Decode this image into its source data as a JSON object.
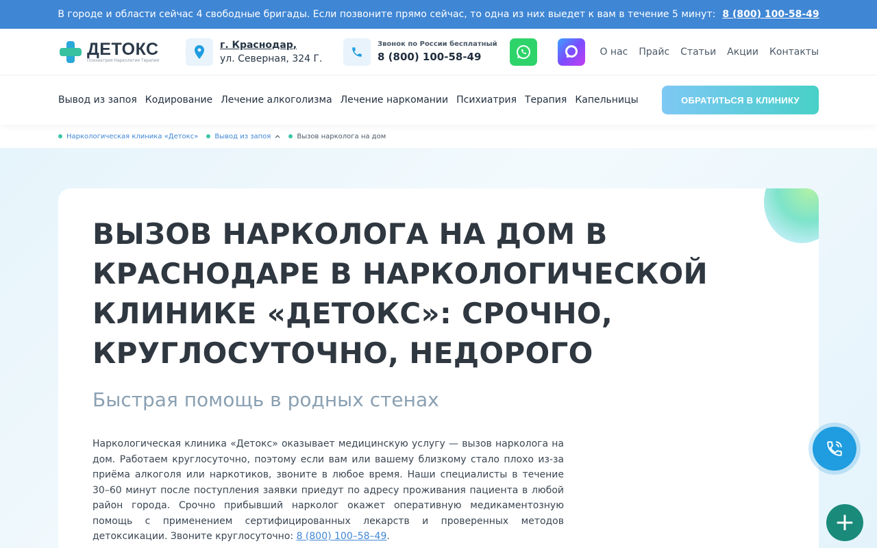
{
  "banner": {
    "text": "В городе и области сейчас 4 свободные бригады. Если позвоните прямо сейчас, то одна из них выедет к вам в течение 5 минут:",
    "phone": "8 (800) 100-58-49"
  },
  "header": {
    "logo_name": "ДЕТОКС",
    "logo_sub": "Психиатрия Наркология Терапия",
    "city": "г. Краснодар,",
    "street": "ул. Северная, 324 Г.",
    "phone_caption": "Звонок по России бесплатный",
    "phone": "8 (800) 100-58-49",
    "top_nav": [
      "О нас",
      "Прайс",
      "Статьи",
      "Акции",
      "Контакты"
    ]
  },
  "main_nav": {
    "items": [
      "Вывод из запоя",
      "Кодирование",
      "Лечение алкоголизма",
      "Лечение наркомании",
      "Психиатрия",
      "Терапия",
      "Капельницы"
    ],
    "cta_label": "ОБРАТИТЬСЯ В КЛИНИКУ"
  },
  "breadcrumbs": {
    "items": [
      "Наркологическая клиника «Детокс»",
      "Вывод из запоя",
      "Вызов нарколога на дом"
    ]
  },
  "hero": {
    "title": "ВЫЗОВ НАРКОЛОГА НА ДОМ В КРАСНОДАРЕ В НАРКОЛОГИЧЕСКОЙ КЛИНИКЕ «ДЕТОКС»: СРОЧНО, КРУГЛОСУТОЧНО, НЕДОРОГО",
    "subtitle": "Быстрая помощь в родных стенах",
    "paragraph": "Наркологическая клиника «Детокс» оказывает медицинскую услугу — вызов нарколога на дом. Работаем круглосуточно, поэтому если вам или вашему близкому стало плохо из-за приёма алкоголя или наркотиков, звоните в любое время. Наши специалисты в течение 30–60 минут после поступления заявки приедут по адресу проживания пациента в любой район города. Срочно прибывший нарколог окажет оперативную медикаментозную помощь с применением сертифицированных лекарств и проверенных методов детоксикации. Звоните круглосуточно:",
    "paragraph_phone": "8 (800) 100–58–49"
  },
  "icons": {
    "location": "map-pin-icon",
    "phone": "phone-icon",
    "whatsapp": "whatsapp-icon",
    "max": "max-messenger-icon",
    "call_fab": "call-icon",
    "plus_fab": "plus-icon"
  },
  "colors": {
    "banner": "#3f86d4",
    "accent_green": "#37c1a0",
    "accent_blue": "#1f9de0",
    "fab_plus": "#1a8a7a"
  }
}
